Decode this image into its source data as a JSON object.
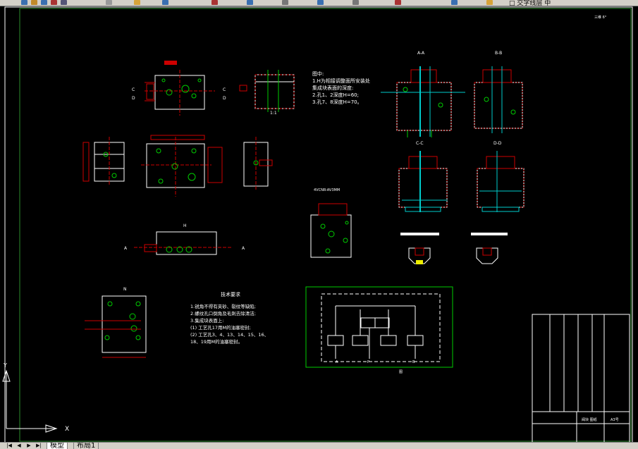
{
  "toolbar": {
    "title_fragment": "□ 交字线层 中"
  },
  "drawing": {
    "corner_mark": "三维 6°",
    "notes_title": "图中:",
    "notes": [
      "1.H为相接调整面所安装处",
      "集成块表面的深度:",
      "2.孔1、2深度H=60;",
      "3.孔7、8深度H=70。"
    ],
    "scale_1": "1:1",
    "section_labels": {
      "aa": "A-A",
      "bb": "B-B",
      "cc": "C-C",
      "dd": "D-D"
    },
    "side_letters": {
      "c": "C",
      "d": "D",
      "a": "A",
      "h": "H",
      "n": "N"
    },
    "small_view_label": "4VCNR-AV3MM",
    "tech_title": "技术要求",
    "tech_lines": [
      "1.锐角不得有夹砂、裂纹等缺陷;",
      "2.螺纹孔口倒角及毛刺去除清洁;",
      "3.集成块表面上:",
      "(1) 工艺孔17用M的油塞密封;",
      "(2) 工艺孔3、4、13、14、15、16、",
      "     18、19用M的油塞密封。"
    ],
    "schematic_ports": {
      "a": "A",
      "p": "P",
      "b": "B",
      "bottom": "图"
    },
    "title_block": {
      "name": "阀块 图纸",
      "code": "A3号"
    },
    "ucs": {
      "x": "X",
      "y": "Y"
    }
  },
  "tabs": {
    "model": "模型",
    "layout": "布局1"
  }
}
